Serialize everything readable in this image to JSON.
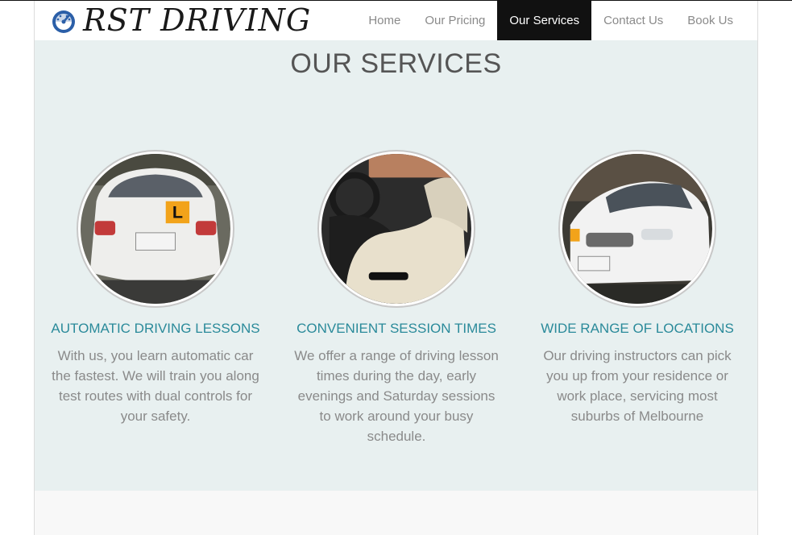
{
  "brand": {
    "name": "RST DRIVING",
    "icon": "speedometer-icon"
  },
  "nav": {
    "items": [
      {
        "label": "Home"
      },
      {
        "label": "Our Pricing"
      },
      {
        "label": "Our Services"
      },
      {
        "label": "Contact Us"
      },
      {
        "label": "Book Us"
      }
    ],
    "active": "Our Services"
  },
  "services": {
    "title": "OUR SERVICES",
    "cards": [
      {
        "title": "AUTOMATIC DRIVING LESSONS",
        "text": "With us, you learn automatic car the fastest. We will train you along test routes with dual controls for your safety.",
        "image": "car-rear-photo"
      },
      {
        "title": "CONVENIENT SESSION TIMES",
        "text": "We offer a range of driving lesson times during the day, early evenings and Saturday sessions to work around your busy schedule.",
        "image": "car-interior-photo"
      },
      {
        "title": "WIDE RANGE OF LOCATIONS",
        "text": "Our driving instructors can pick you up from your residence or work place, servicing most suburbs of Melbourne",
        "image": "car-front-photo"
      }
    ]
  },
  "colors": {
    "accent": "#2a8a9a",
    "nav_active_bg": "#111111",
    "section_bg": "#e8f0f0",
    "logo_icon": "#2b5fa8"
  }
}
